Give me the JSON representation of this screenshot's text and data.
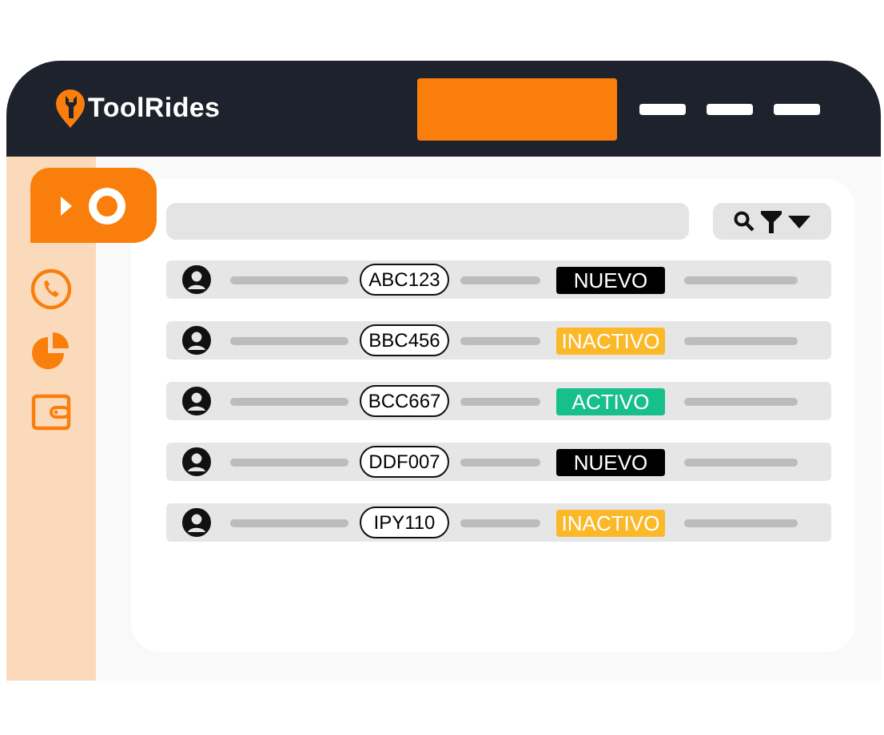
{
  "brand": {
    "name": "ToolRides"
  },
  "sidebar": {
    "items": [
      {
        "kind": "media",
        "selected": true
      },
      {
        "kind": "phone",
        "selected": false
      },
      {
        "kind": "chart",
        "selected": false
      },
      {
        "kind": "wallet",
        "selected": false
      }
    ]
  },
  "rows": [
    {
      "plate": "ABC123",
      "status": "NUEVO",
      "color": "#000000"
    },
    {
      "plate": "BBC456",
      "status": "INACTIVO",
      "color": "#fbb829"
    },
    {
      "plate": "BCC667",
      "status": "ACTIVO",
      "color": "#17bf8a"
    },
    {
      "plate": "DDF007",
      "status": "NUEVO",
      "color": "#000000"
    },
    {
      "plate": "IPY110",
      "status": "INACTIVO",
      "color": "#fbb829"
    }
  ]
}
